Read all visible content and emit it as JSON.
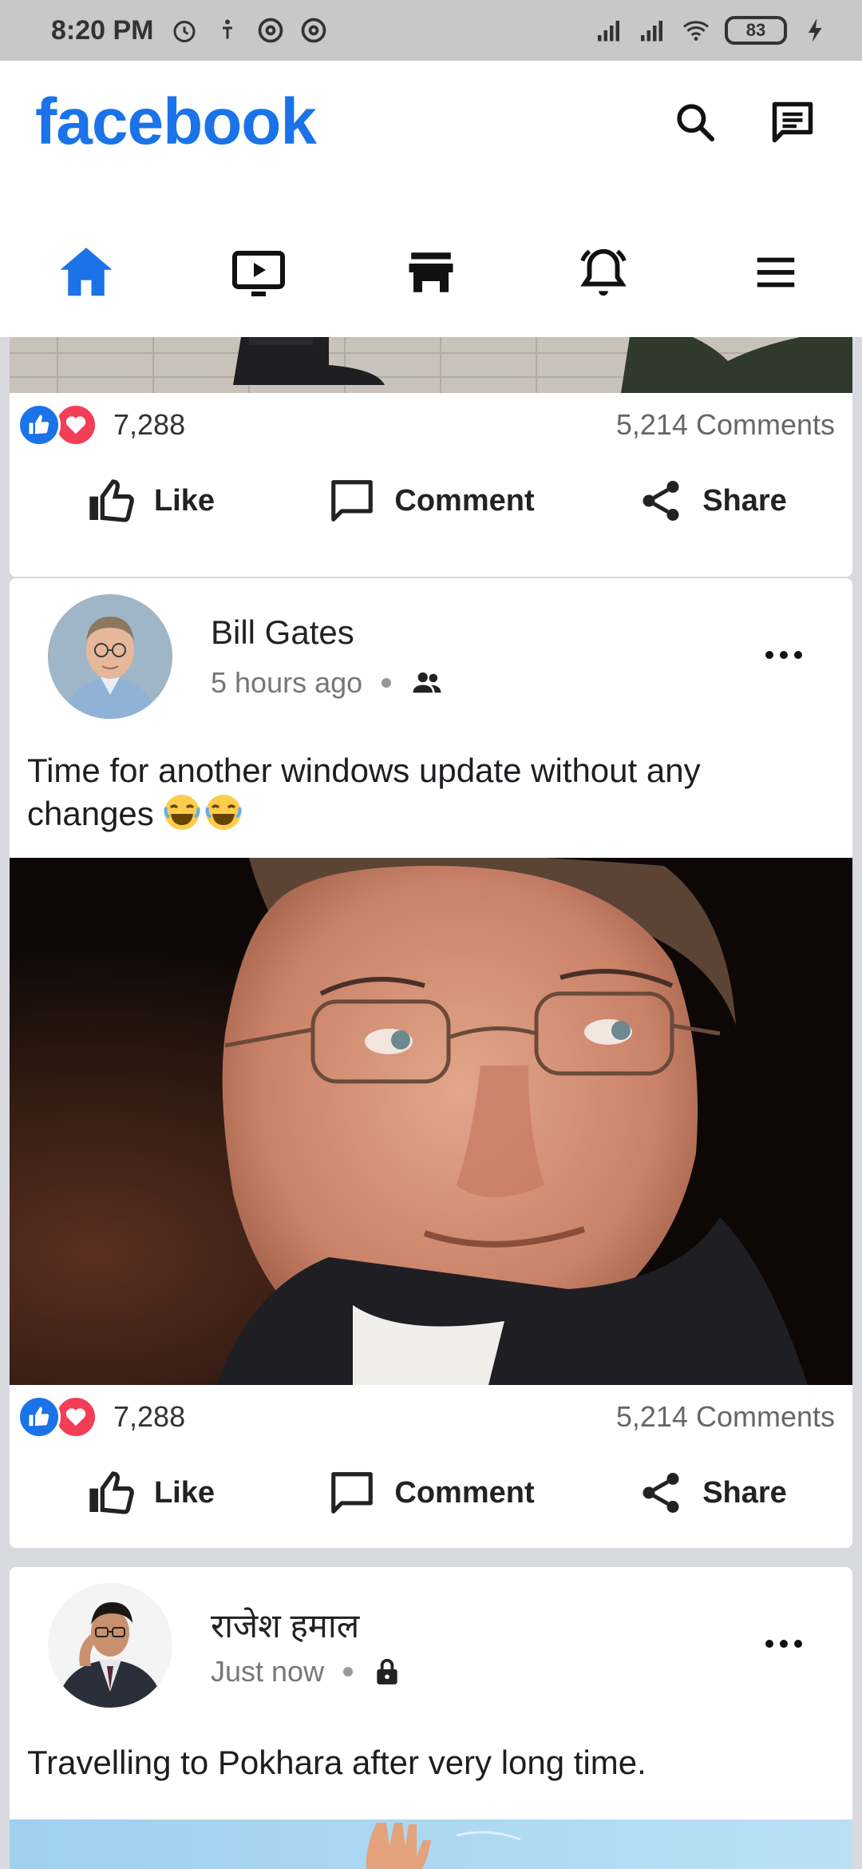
{
  "status_bar": {
    "time": "8:20 PM",
    "battery": "83"
  },
  "header": {
    "logo": "facebook"
  },
  "nav": {
    "tabs": [
      {
        "icon": "home-icon",
        "active": true
      },
      {
        "icon": "watch-icon",
        "active": false
      },
      {
        "icon": "marketplace-icon",
        "active": false
      },
      {
        "icon": "notifications-icon",
        "active": false
      },
      {
        "icon": "menu-icon",
        "active": false
      }
    ]
  },
  "colors": {
    "brand": "#1a73e8",
    "like": "#1a73e8",
    "love": "#f33e58"
  },
  "posts": [
    {
      "reaction_count": "7,288",
      "comment_count": "5,214  Comments",
      "actions": {
        "like": "Like",
        "comment": "Comment",
        "share": "Share"
      }
    },
    {
      "author": "Bill Gates",
      "time": "5 hours ago",
      "audience_icon": "friends-icon",
      "text": "Time for another windows update without any changes",
      "reaction_count": "7,288",
      "comment_count": "5,214  Comments",
      "actions": {
        "like": "Like",
        "comment": "Comment",
        "share": "Share"
      }
    },
    {
      "author": "राजेश हमाल",
      "time": "Just now",
      "audience_icon": "lock-icon",
      "text": "Travelling to Pokhara after very long time."
    }
  ]
}
